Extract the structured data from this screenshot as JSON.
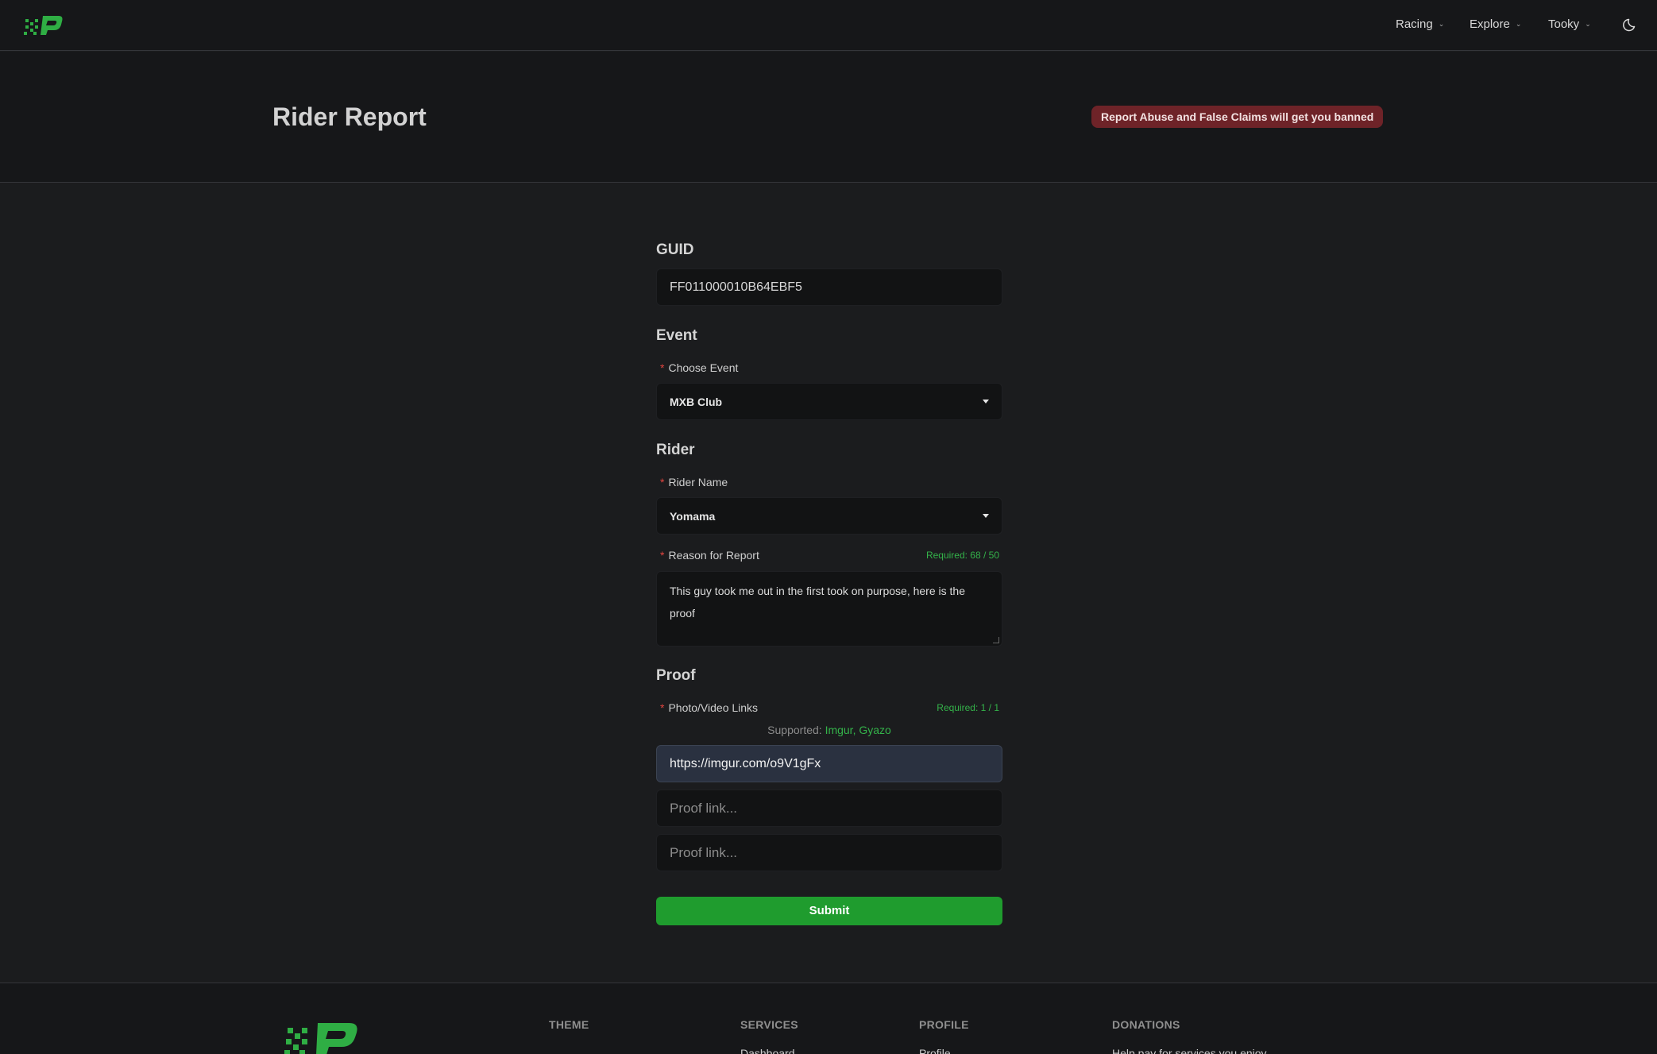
{
  "nav": {
    "items": [
      {
        "label": "Racing"
      },
      {
        "label": "Explore"
      },
      {
        "label": "Tooky"
      }
    ],
    "theme_icon": "moon-icon",
    "logo": "checkered-p-logo"
  },
  "header": {
    "title": "Rider Report",
    "warning": "Report Abuse and False Claims will get you banned"
  },
  "form": {
    "guid": {
      "section_title": "GUID",
      "value": "FF011000010B64EBF5"
    },
    "event": {
      "section_title": "Event",
      "label": "Choose Event",
      "selected": "MXB Club"
    },
    "rider": {
      "section_title": "Rider",
      "name_label": "Rider Name",
      "name_selected": "Yomama",
      "reason_label": "Reason for Report",
      "reason_counter": "Required: 68 / 50",
      "reason_text": "This guy took me out in the first took on purpose, here is the proof"
    },
    "proof": {
      "section_title": "Proof",
      "label": "Photo/Video Links",
      "counter": "Required: 1 / 1",
      "supported_prefix": "Supported:",
      "supported_sites": "Imgur, Gyazo",
      "links": [
        {
          "value": "https://imgur.com/o9V1gFx",
          "placeholder": "Proof link..."
        },
        {
          "value": "",
          "placeholder": "Proof link..."
        },
        {
          "value": "",
          "placeholder": "Proof link..."
        }
      ]
    },
    "submit_label": "Submit",
    "required_marker": "*"
  },
  "footer": {
    "columns": [
      {
        "head": "THEME",
        "item": ""
      },
      {
        "head": "SERVICES",
        "item": "Dashboard"
      },
      {
        "head": "PROFILE",
        "item": "Profile"
      },
      {
        "head": "DONATIONS",
        "item": "Help pay for services you enjoy"
      }
    ]
  },
  "colors": {
    "accent_green": "#1f9c2e",
    "warning_bg": "#6e2328",
    "required_red": "#e0453f",
    "filled_input_bg": "#2a3140"
  }
}
